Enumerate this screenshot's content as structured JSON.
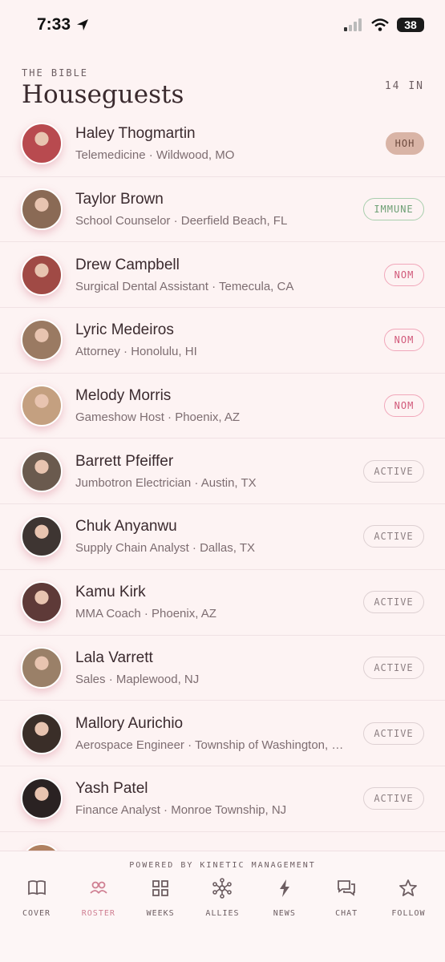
{
  "status_bar": {
    "time": "7:33",
    "battery": "38"
  },
  "header": {
    "kicker": "THE BIBLE",
    "title": "Houseguests",
    "count": "14 IN"
  },
  "colors": {
    "accent": "#cf7f92",
    "background": "#fdf3f3",
    "hoh": "#d9b4a6",
    "immune": "#6d9f74",
    "nom": "#d1597a"
  },
  "houseguests": [
    {
      "name": "Haley Thogmartin",
      "detail": "Telemedicine · Wildwood, MO",
      "status": "HOH",
      "status_type": "hoh"
    },
    {
      "name": "Taylor Brown",
      "detail": "School Counselor · Deerfield Beach, FL",
      "status": "IMMUNE",
      "status_type": "immune"
    },
    {
      "name": "Drew Campbell",
      "detail": "Surgical Dental Assistant · Temecula, CA",
      "status": "NOM",
      "status_type": "nom"
    },
    {
      "name": "Lyric Medeiros",
      "detail": "Attorney · Honolulu, HI",
      "status": "NOM",
      "status_type": "nom"
    },
    {
      "name": "Melody Morris",
      "detail": "Gameshow Host · Phoenix, AZ",
      "status": "NOM",
      "status_type": "nom"
    },
    {
      "name": "Barrett Pfeiffer",
      "detail": "Jumbotron Electrician · Austin, TX",
      "status": "ACTIVE",
      "status_type": "active"
    },
    {
      "name": "Chuk Anyanwu",
      "detail": "Supply Chain Analyst · Dallas, TX",
      "status": "ACTIVE",
      "status_type": "active"
    },
    {
      "name": "Kamu Kirk",
      "detail": "MMA Coach · Phoenix, AZ",
      "status": "ACTIVE",
      "status_type": "active"
    },
    {
      "name": "Lala Varrett",
      "detail": "Sales · Maplewood, NJ",
      "status": "ACTIVE",
      "status_type": "active"
    },
    {
      "name": "Mallory Aurichio",
      "detail": "Aerospace Engineer · Township of Washington, …",
      "status": "ACTIVE",
      "status_type": "active"
    },
    {
      "name": "Yash Patel",
      "detail": "Finance Analyst · Monroe Township, NJ",
      "status": "ACTIVE",
      "status_type": "active"
    },
    {
      "name": "",
      "detail": "",
      "status": "",
      "status_type": "partial"
    }
  ],
  "footer": {
    "powered_by": "POWERED BY KINETIC MANAGEMENT",
    "tabs": [
      {
        "label": "COVER",
        "icon": "book-icon",
        "active": false
      },
      {
        "label": "ROSTER",
        "icon": "people-icon",
        "active": true
      },
      {
        "label": "WEEKS",
        "icon": "grid-icon",
        "active": false
      },
      {
        "label": "ALLIES",
        "icon": "network-icon",
        "active": false
      },
      {
        "label": "NEWS",
        "icon": "bolt-icon",
        "active": false
      },
      {
        "label": "CHAT",
        "icon": "chat-icon",
        "active": false
      },
      {
        "label": "FOLLOW",
        "icon": "star-icon",
        "active": false
      }
    ]
  }
}
